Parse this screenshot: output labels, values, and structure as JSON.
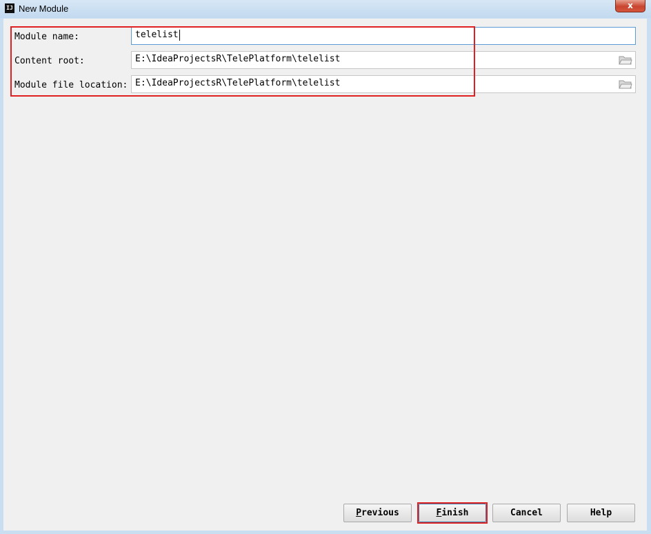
{
  "window": {
    "title": "New Module",
    "app_icon_text": "IJ",
    "close_glyph": "x"
  },
  "form": {
    "module_name": {
      "label": "Module name:",
      "value": "telelist"
    },
    "content_root": {
      "label": "Content root:",
      "value": "E:\\IdeaProjectsR\\TelePlatform\\telelist",
      "icon": "folder-icon"
    },
    "module_file_location": {
      "label": "Module file location:",
      "value": "E:\\IdeaProjectsR\\TelePlatform\\telelist",
      "icon": "folder-icon"
    }
  },
  "buttons": {
    "previous": {
      "mnemonic": "P",
      "rest": "revious"
    },
    "finish": {
      "mnemonic": "F",
      "rest": "inish"
    },
    "cancel": {
      "label": "Cancel"
    },
    "help": {
      "label": "Help"
    }
  },
  "colors": {
    "highlight": "#e02020",
    "focus_border": "#5a9bd5",
    "dialog_background": "#f0f0f0"
  }
}
